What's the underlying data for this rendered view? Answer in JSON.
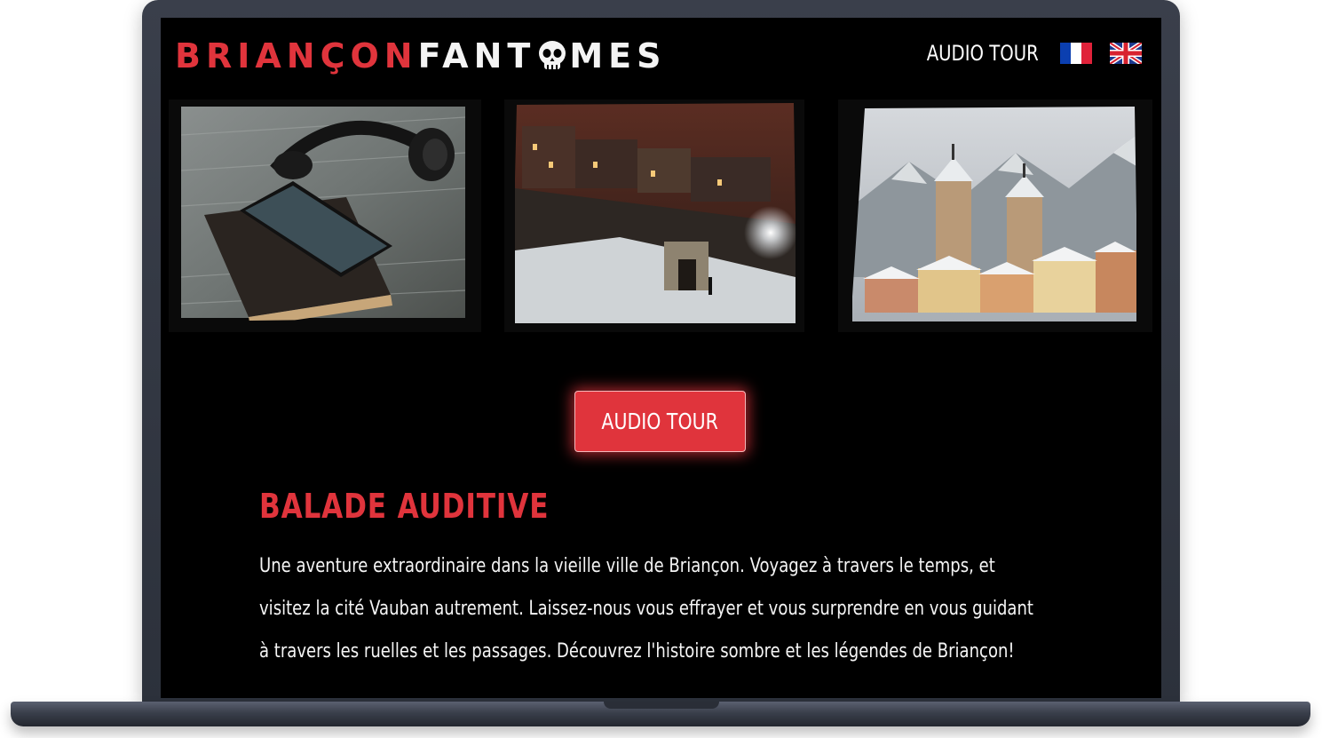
{
  "header": {
    "logo_part1": "BRIANÇON",
    "logo_part2a": "FANT",
    "logo_part2b": "MES",
    "nav_link": "AUDIO TOUR",
    "languages": [
      "fr-flag-icon",
      "uk-flag-icon"
    ]
  },
  "gallery": {
    "images": [
      "headphones-phone-book-photo",
      "night-snow-street-photo",
      "snowy-town-church-photo"
    ]
  },
  "cta": {
    "label": "AUDIO TOUR"
  },
  "content": {
    "title": "BALADE AUDITIVE",
    "body": "Une aventure extraordinaire dans la vieille ville de Briançon. Voyagez à travers le temps, et visitez la cité Vauban autrement. Laissez-nous vous effrayer et vous surprendre en vous guidant à travers les ruelles et les passages. Découvrez l'histoire sombre et les légendes de Briançon!"
  },
  "colors": {
    "accent": "#e0343c",
    "background": "#000000",
    "frame": "#2c313b"
  }
}
